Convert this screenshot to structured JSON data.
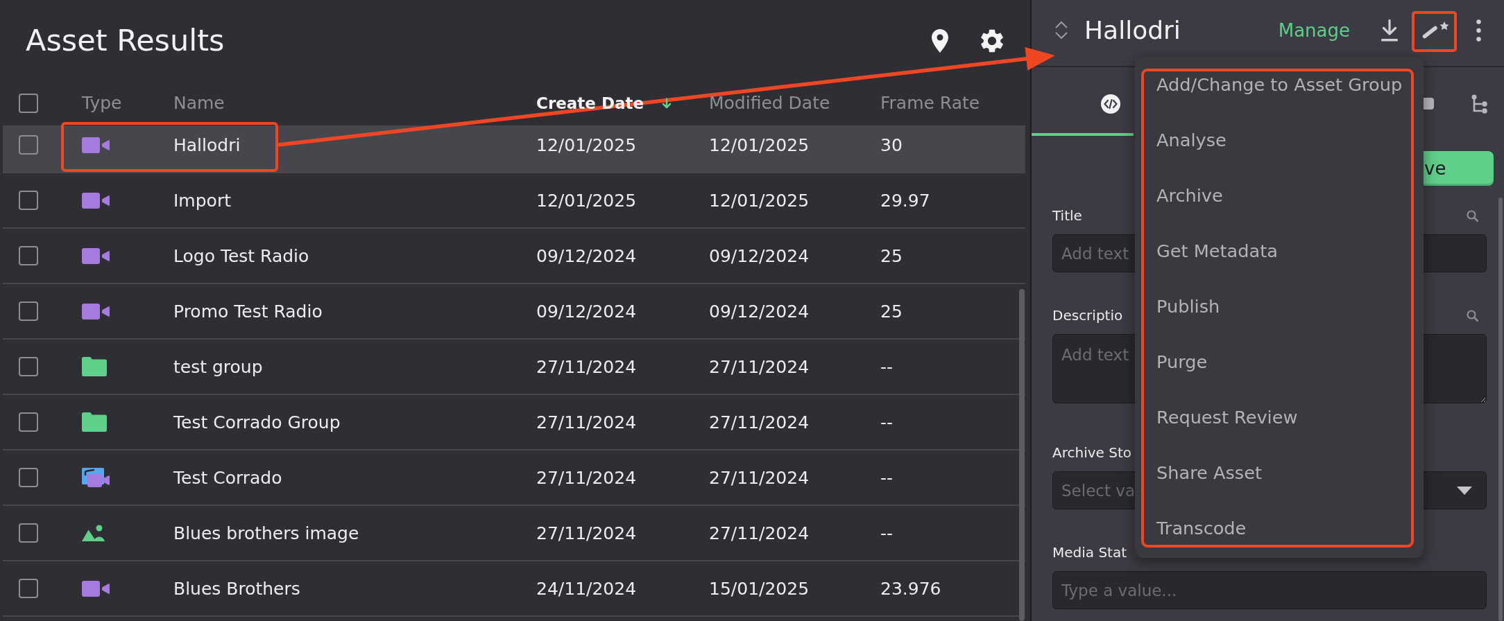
{
  "results_panel": {
    "title": "Asset Results",
    "table": {
      "select_all": {
        "checked": false
      },
      "columns": [
        {
          "label": "Type",
          "sorted": false
        },
        {
          "label": "Name",
          "sorted": false
        },
        {
          "label": "Create Date",
          "sorted": true
        },
        {
          "label": "Modified Date",
          "sorted": false
        },
        {
          "label": "Frame Rate",
          "sorted": false
        }
      ],
      "rows": [
        {
          "kind": "video",
          "name": "Hallodri",
          "create_date": "12/01/2025",
          "modified_date": "12/01/2025",
          "frame_rate": "30",
          "selected": true,
          "checked": false
        },
        {
          "kind": "video",
          "name": "Import",
          "create_date": "12/01/2025",
          "modified_date": "12/01/2025",
          "frame_rate": "29.97",
          "selected": false,
          "checked": false
        },
        {
          "kind": "video",
          "name": "Logo Test Radio",
          "create_date": "09/12/2024",
          "modified_date": "09/12/2024",
          "frame_rate": "25",
          "selected": false,
          "checked": false
        },
        {
          "kind": "video",
          "name": "Promo Test Radio",
          "create_date": "09/12/2024",
          "modified_date": "09/12/2024",
          "frame_rate": "25",
          "selected": false,
          "checked": false
        },
        {
          "kind": "folder",
          "name": "test group",
          "create_date": "27/11/2024",
          "modified_date": "27/11/2024",
          "frame_rate": "--",
          "selected": false,
          "checked": false
        },
        {
          "kind": "folder",
          "name": "Test Corrado Group",
          "create_date": "27/11/2024",
          "modified_date": "27/11/2024",
          "frame_rate": "--",
          "selected": false,
          "checked": false
        },
        {
          "kind": "composite",
          "name": "Test Corrado",
          "create_date": "27/11/2024",
          "modified_date": "27/11/2024",
          "frame_rate": "--",
          "selected": false,
          "checked": false
        },
        {
          "kind": "image",
          "name": "Blues brothers image",
          "create_date": "27/11/2024",
          "modified_date": "27/11/2024",
          "frame_rate": "--",
          "selected": false,
          "checked": false
        },
        {
          "kind": "video",
          "name": "Blues Brothers",
          "create_date": "24/11/2024",
          "modified_date": "15/01/2025",
          "frame_rate": "23.976",
          "selected": false,
          "checked": false
        }
      ]
    }
  },
  "detail_panel": {
    "title": "Hallodri",
    "manage_link": "Manage",
    "tabs": [
      {
        "kind": "code",
        "selected": true
      },
      {
        "kind": "document",
        "selected": false
      },
      {
        "kind": "tree",
        "selected": false
      }
    ],
    "primary_button": {
      "label": "ve"
    },
    "fields": [
      {
        "label": "Title",
        "kind": "text",
        "placeholder": "Add text",
        "searchable": true
      },
      {
        "label": "Descriptio",
        "kind": "textarea",
        "placeholder": "Add text",
        "searchable": true
      },
      {
        "label": "Archive Sto",
        "kind": "select",
        "placeholder": "Select va"
      },
      {
        "label": "Media Stat",
        "kind": "text",
        "placeholder": "Type a value..."
      }
    ]
  },
  "actions_menu": {
    "items": [
      "Add/Change to Asset Group",
      "Analyse",
      "Archive",
      "Get Metadata",
      "Publish",
      "Purge",
      "Request Review",
      "Share Asset",
      "Transcode"
    ]
  },
  "annotations": [
    {
      "kind": "frame"
    },
    {
      "kind": "arrow"
    },
    {
      "kind": "frame"
    },
    {
      "kind": "frame"
    }
  ]
}
